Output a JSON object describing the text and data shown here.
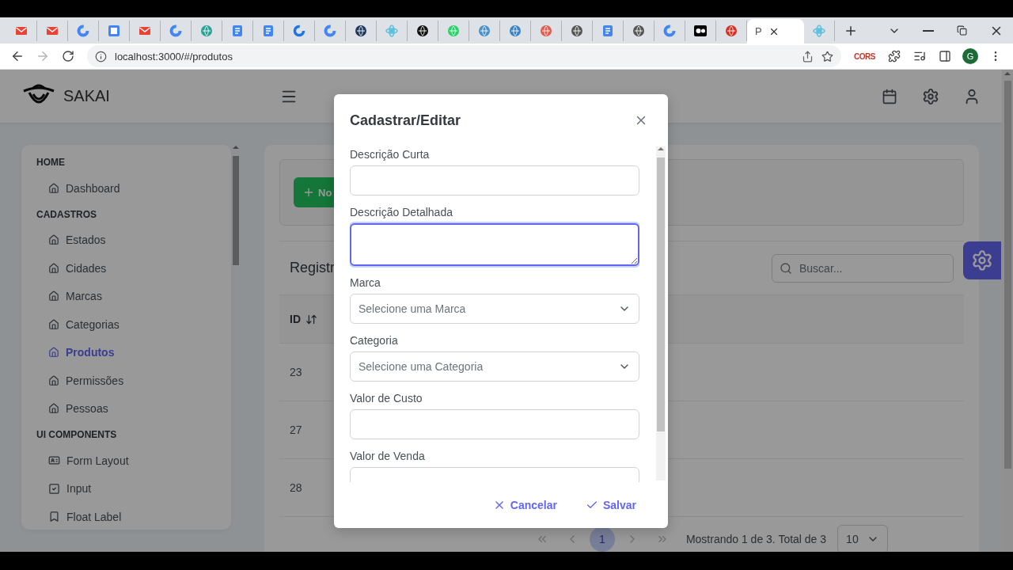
{
  "browser": {
    "tabs": [
      {
        "kind": "mail",
        "color": "#ea4335",
        "selected": false
      },
      {
        "kind": "mail",
        "color": "#ea4335",
        "selected": false
      },
      {
        "kind": "google",
        "color": "#4285f4",
        "selected": false
      },
      {
        "kind": "calendar",
        "color": "#4285f4",
        "selected": false
      },
      {
        "kind": "mail",
        "color": "#ea4335",
        "selected": false
      },
      {
        "kind": "google",
        "color": "#4285f4",
        "selected": false
      },
      {
        "kind": "globe",
        "color": "#2aa198",
        "selected": false
      },
      {
        "kind": "doc",
        "color": "#4285f4",
        "selected": false
      },
      {
        "kind": "doc",
        "color": "#4285f4",
        "selected": false
      },
      {
        "kind": "ring",
        "color": "#1a73e8",
        "selected": false
      },
      {
        "kind": "google",
        "color": "#4285f4",
        "selected": false
      },
      {
        "kind": "globe",
        "color": "#1e3a5f",
        "selected": false
      },
      {
        "kind": "atom",
        "color": "#5bc0de",
        "selected": false
      },
      {
        "kind": "globe",
        "color": "#111111",
        "selected": false
      },
      {
        "kind": "globe",
        "color": "#25d366",
        "selected": false
      },
      {
        "kind": "globe",
        "color": "#4a90c8",
        "selected": false
      },
      {
        "kind": "globe",
        "color": "#3b82c4",
        "selected": false
      },
      {
        "kind": "globe",
        "color": "#e25b4b",
        "selected": false
      },
      {
        "kind": "globe",
        "color": "#555555",
        "selected": false
      },
      {
        "kind": "doc",
        "color": "#4285f4",
        "selected": false
      },
      {
        "kind": "globe",
        "color": "#555555",
        "selected": false
      },
      {
        "kind": "google",
        "color": "#4285f4",
        "selected": false
      },
      {
        "kind": "media",
        "color": "#000000",
        "selected": false
      },
      {
        "kind": "globe",
        "color": "#d93025",
        "selected": false
      },
      {
        "kind": "blank",
        "selected": true,
        "title": "P"
      },
      {
        "kind": "atom",
        "color": "#5bc0de",
        "selected": false
      }
    ],
    "forward_disabled": true,
    "url": "localhost:3000/#/produtos",
    "extension_label": "CORS",
    "profile_initial": "G"
  },
  "app": {
    "brand": "SAKAI",
    "sidebar": [
      {
        "title": "HOME",
        "items": [
          {
            "label": "Dashboard",
            "kind": "home",
            "selected": false
          }
        ]
      },
      {
        "title": "CADASTROS",
        "items": [
          {
            "label": "Estados",
            "kind": "home",
            "selected": false
          },
          {
            "label": "Cidades",
            "kind": "home",
            "selected": false
          },
          {
            "label": "Marcas",
            "kind": "home",
            "selected": false
          },
          {
            "label": "Categorias",
            "kind": "home",
            "selected": false
          },
          {
            "label": "Produtos",
            "kind": "home",
            "selected": true
          },
          {
            "label": "Permissões",
            "kind": "home",
            "selected": false
          },
          {
            "label": "Pessoas",
            "kind": "home",
            "selected": false
          }
        ]
      },
      {
        "title": "UI COMPONENTS",
        "items": [
          {
            "label": "Form Layout",
            "kind": "form",
            "selected": false
          },
          {
            "label": "Input",
            "kind": "check",
            "selected": false
          },
          {
            "label": "Float Label",
            "kind": "bookmark",
            "selected": false
          }
        ]
      }
    ],
    "new_button": "No",
    "table_title": "Registr",
    "search": {
      "placeholder": "Buscar..."
    },
    "columns": [
      {
        "label": "ID",
        "sortable": true
      }
    ],
    "rows": [
      {
        "id": "23"
      },
      {
        "id": "27"
      },
      {
        "id": "28"
      }
    ],
    "pagination": {
      "nav_disabled": true,
      "pages": [
        {
          "label": "1",
          "selected": true
        }
      ],
      "report": "Mostrando 1 de 3. Total de 3",
      "rows_per_page": "10"
    }
  },
  "dialog": {
    "title": "Cadastrar/Editar",
    "fields": [
      {
        "label": "Descrição Curta",
        "kind": "text",
        "focused": false
      },
      {
        "label": "Descrição Detalhada",
        "kind": "textarea",
        "focused": true
      },
      {
        "label": "Marca",
        "kind": "select",
        "placeholder": "Selecione uma Marca",
        "focused": false
      },
      {
        "label": "Categoria",
        "kind": "select",
        "placeholder": "Selecione uma Categoria",
        "focused": false
      },
      {
        "label": "Valor de Custo",
        "kind": "text",
        "focused": false
      },
      {
        "label": "Valor de Venda",
        "kind": "text",
        "focused": false
      }
    ],
    "buttons": [
      {
        "label": "Cancelar",
        "kind": "cancel"
      },
      {
        "label": "Salvar",
        "kind": "save"
      }
    ]
  }
}
